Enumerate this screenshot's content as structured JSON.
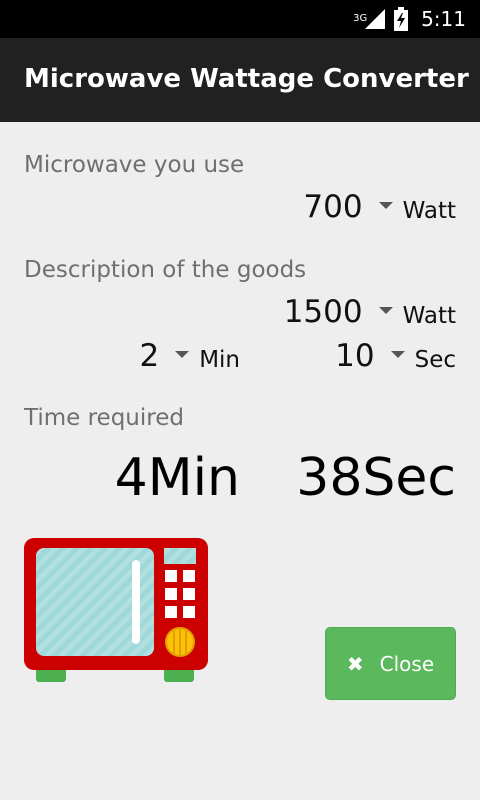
{
  "status_bar": {
    "network": "3G",
    "time": "5:11"
  },
  "app_title": "Microwave Wattage Converter",
  "microwave_section": {
    "label": "Microwave you use",
    "wattage": {
      "value": "700",
      "unit": "Watt"
    }
  },
  "goods_section": {
    "label": "Description of the goods",
    "wattage": {
      "value": "1500",
      "unit": "Watt"
    },
    "minutes": {
      "value": "2",
      "unit": "Min"
    },
    "seconds": {
      "value": "10",
      "unit": "Sec"
    }
  },
  "result_section": {
    "label": "Time required",
    "minutes": "4Min",
    "seconds": "38Sec"
  },
  "close_button": {
    "label": "Close",
    "icon": "close-icon"
  },
  "colors": {
    "app_bar": "#212121",
    "background": "#eeeeee",
    "button": "#5cb85c",
    "microwave_body": "#cc0000",
    "microwave_window": "#9fd8d8",
    "microwave_knob": "#ffc107",
    "microwave_feet": "#4caf50"
  }
}
